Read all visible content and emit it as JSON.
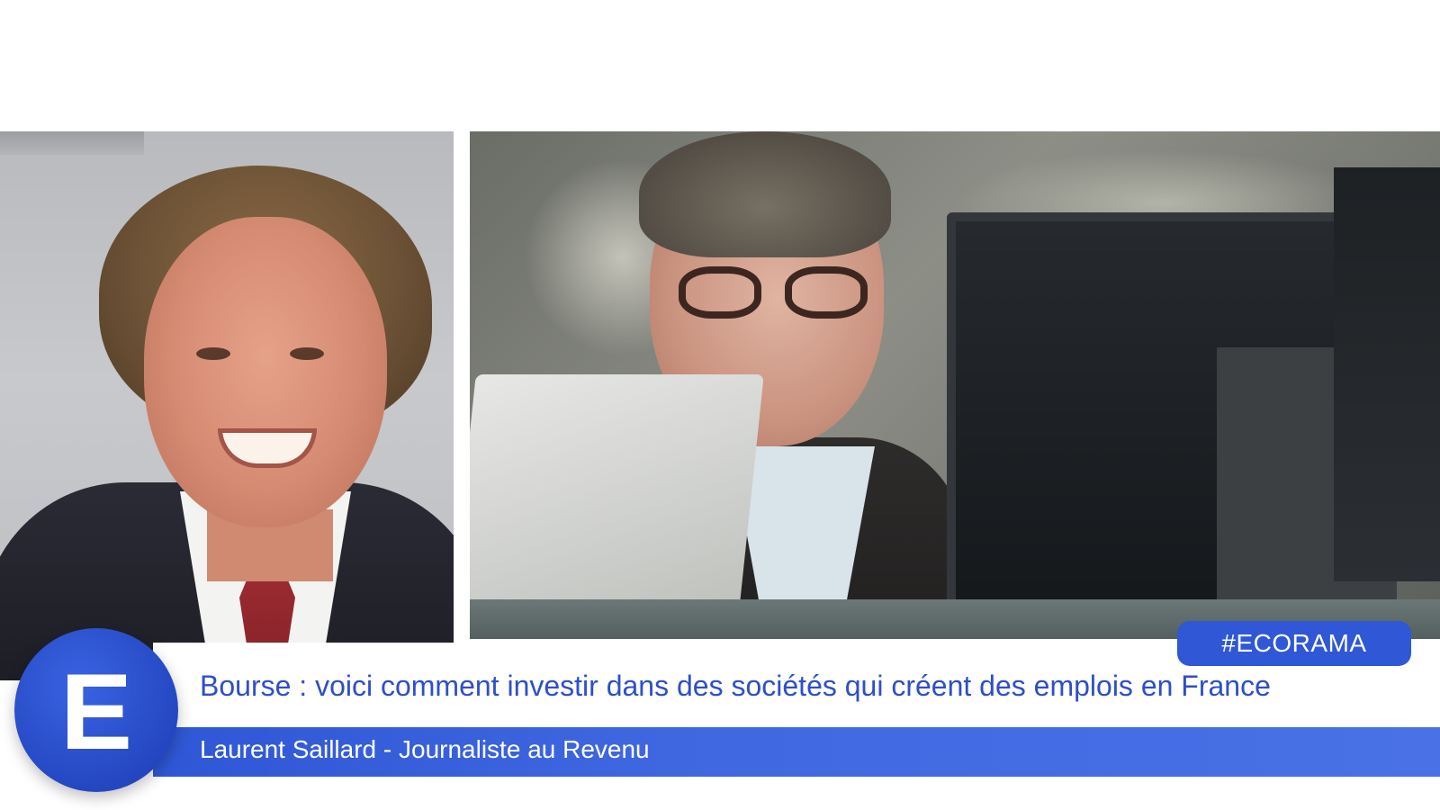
{
  "headline": "Bourse : voici comment investir dans des sociétés qui créent des emplois en France",
  "speaker": "Laurent Saillard - Journaliste au Revenu",
  "hashtag": "#ECORAMA",
  "logo_letter": "E",
  "colors": {
    "brand_blue": "#2f57d6",
    "headline_text": "#2d4fc8",
    "background": "#ffffff"
  },
  "icons": {
    "logo": "ecorama-e-logo"
  }
}
